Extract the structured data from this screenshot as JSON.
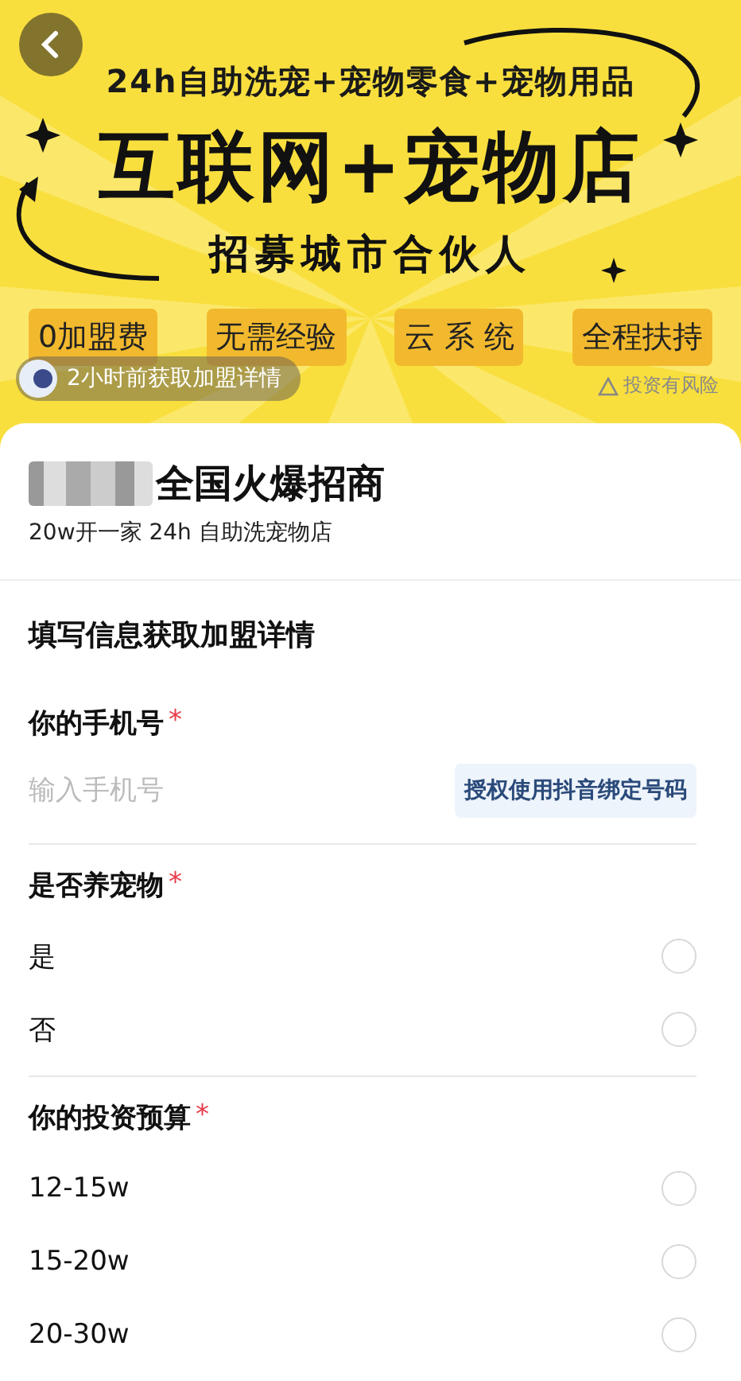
{
  "banner": {
    "subtitle": "24h自助洗宠+宠物零食+宠物用品",
    "headline": "互联网+宠物店",
    "tagline": "招募城市合伙人",
    "features": [
      "0加盟费",
      "无需经验",
      "云 系 统",
      "全程扶持"
    ],
    "toast": "2小时前获取加盟详情",
    "risk_note": "投资有风险"
  },
  "header": {
    "title": "全国火爆招商",
    "subtitle": "20w开一家 24h 自助洗宠物店"
  },
  "form": {
    "title": "填写信息获取加盟详情",
    "fields": [
      {
        "kind": "phone",
        "label": "你的手机号",
        "required_mark": "*",
        "placeholder": "输入手机号",
        "button": "授权使用抖音绑定号码"
      },
      {
        "kind": "radio",
        "label": "是否养宠物",
        "required_mark": "*",
        "options": [
          {
            "label": "是",
            "selected": false
          },
          {
            "label": "否",
            "selected": false
          }
        ]
      },
      {
        "kind": "radio",
        "label": "你的投资预算",
        "required_mark": "*",
        "options": [
          {
            "label": "12-15w",
            "selected": false
          },
          {
            "label": "15-20w",
            "selected": false
          },
          {
            "label": "20-30w",
            "selected": false
          }
        ]
      }
    ]
  }
}
